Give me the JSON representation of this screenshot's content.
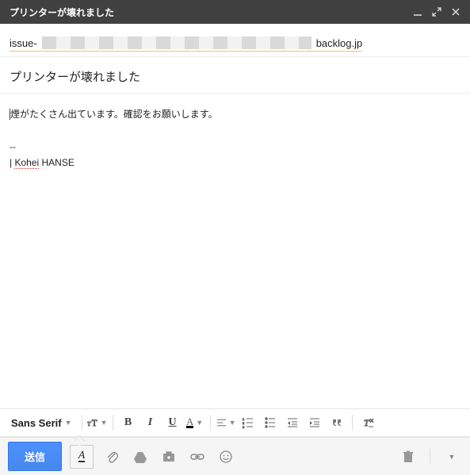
{
  "header": {
    "title": "プリンターが壊れました"
  },
  "recipient": {
    "prefix": "issue-",
    "suffix": "backlog.jp"
  },
  "subject": "プリンターが壊れました",
  "body": {
    "line1": "煙がたくさん出ています。確認をお願いします。",
    "sigsep": "--",
    "signame1": "Kohei",
    "signame2": "HANSE"
  },
  "format": {
    "font": "Sans Serif"
  },
  "actions": {
    "send": "送信"
  }
}
